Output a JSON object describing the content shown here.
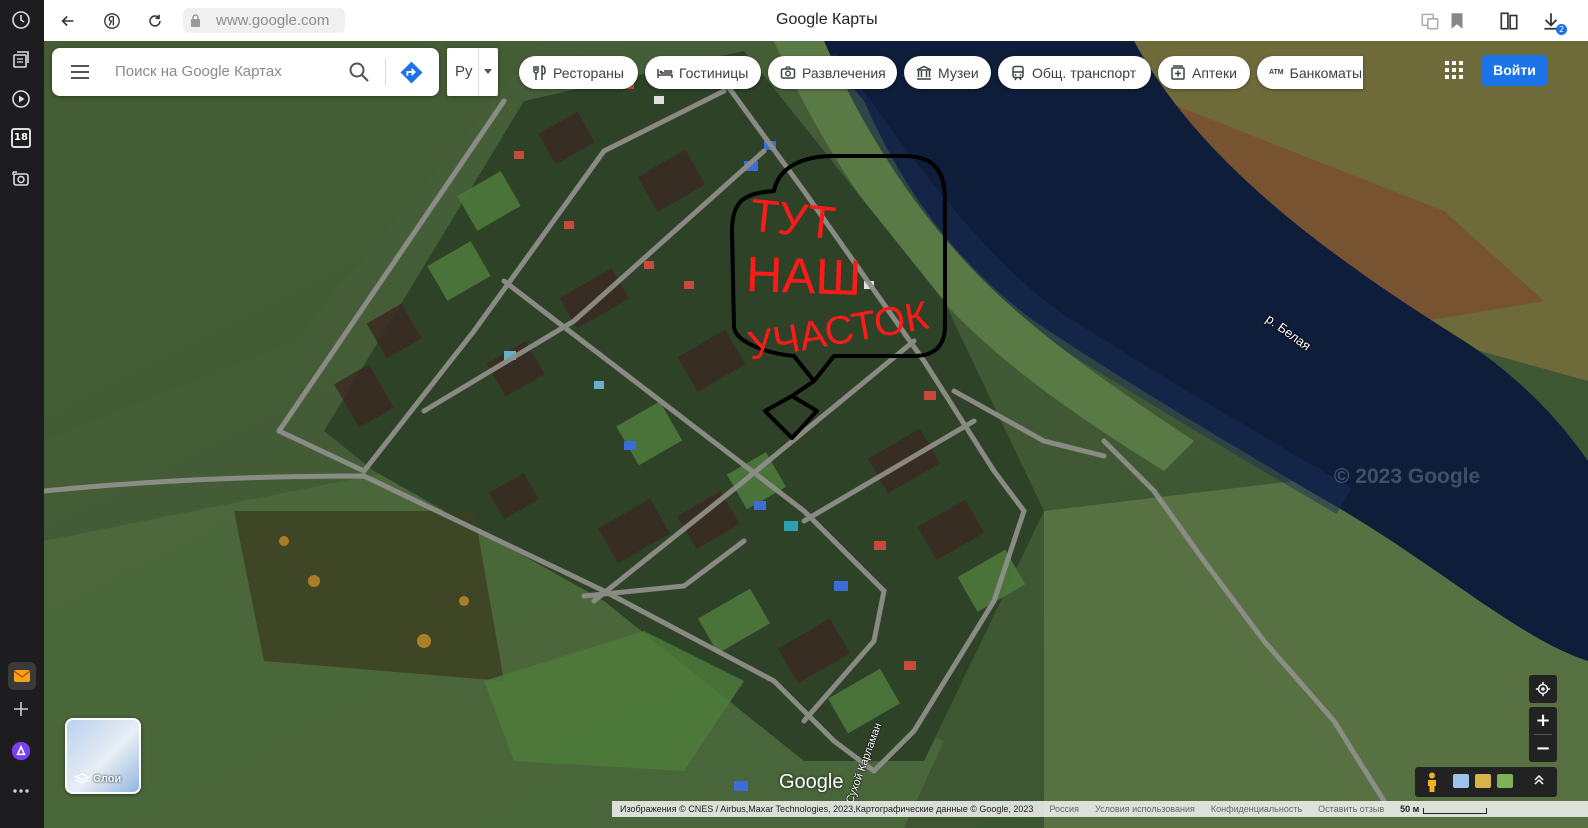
{
  "browser": {
    "url": "www.google.com",
    "page_title": "Google Карты",
    "download_badge": "2"
  },
  "sidebar": {
    "calendar_day": "18",
    "icons": [
      "history-icon",
      "tabs-icon",
      "video-icon",
      "calendar-icon",
      "screenshot-icon",
      "mail-icon",
      "add-icon",
      "alice-icon",
      "more-icon"
    ]
  },
  "search": {
    "placeholder": "Поиск на Google Картах",
    "lang_label": "Ру"
  },
  "categories": [
    {
      "label": "Рестораны",
      "icon": "restaurant-icon"
    },
    {
      "label": "Гостиницы",
      "icon": "hotel-icon"
    },
    {
      "label": "Развлечения",
      "icon": "camera-icon"
    },
    {
      "label": "Музеи",
      "icon": "museum-icon"
    },
    {
      "label": "Общ. транспорт",
      "icon": "transit-icon"
    },
    {
      "label": "Аптеки",
      "icon": "pharmacy-icon"
    },
    {
      "label": "Банкоматы",
      "icon": "atm-icon"
    }
  ],
  "atm_icon_text": "ATM",
  "signin_label": "Войти",
  "layers_label": "Слои",
  "google_logo": "Google",
  "annotation": {
    "lines": [
      "ТУТ",
      "НАШ",
      "УЧАСТОК"
    ]
  },
  "map_labels": {
    "river": "р. Белая",
    "road": "Сухой Карламан",
    "watermark": "© 2023 Google"
  },
  "footer": {
    "imagery": "Изображения © CNES / Airbus,Maxar Technologies, 2023,Картографические данные © Google, 2023",
    "country": "Россия",
    "terms": "Условия использования",
    "privacy": "Конфиденциальность",
    "feedback": "Оставить отзыв",
    "scale": "50 м"
  },
  "colors": {
    "accent": "#1a73e8",
    "annotation_red": "#ff1a1a",
    "annotation_black": "#000000",
    "river": "#0e1d3a",
    "farmland": "#3f5a32"
  }
}
